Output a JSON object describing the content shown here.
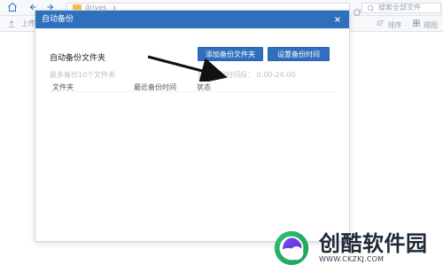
{
  "background": {
    "address_path": "drives",
    "search_placeholder": "搜索全部文件",
    "toolbar_left_label": "上传",
    "toolbar_sort_label": "排序",
    "toolbar_view_label": "视图"
  },
  "dialog": {
    "title": "自动备份",
    "section_title": "自动备份文件夹",
    "buttons": {
      "add_folder": "添加备份文件夹",
      "set_time": "设置备份时间"
    },
    "hint_left": "最多备份10个文件夹",
    "hint_right": "自动备份时间段： 0:00-24:00",
    "table": {
      "columns": [
        "文件夹",
        "最近备份时间",
        "状态"
      ]
    }
  },
  "watermark": {
    "name": "创酷软件园",
    "url": "WWW.CKZKJ.COM"
  },
  "colors": {
    "primary": "#2f6fbe",
    "folder": "#f3c04d",
    "watermark_green": "#2fbe6e",
    "watermark_purple": "#6b3fd6"
  }
}
